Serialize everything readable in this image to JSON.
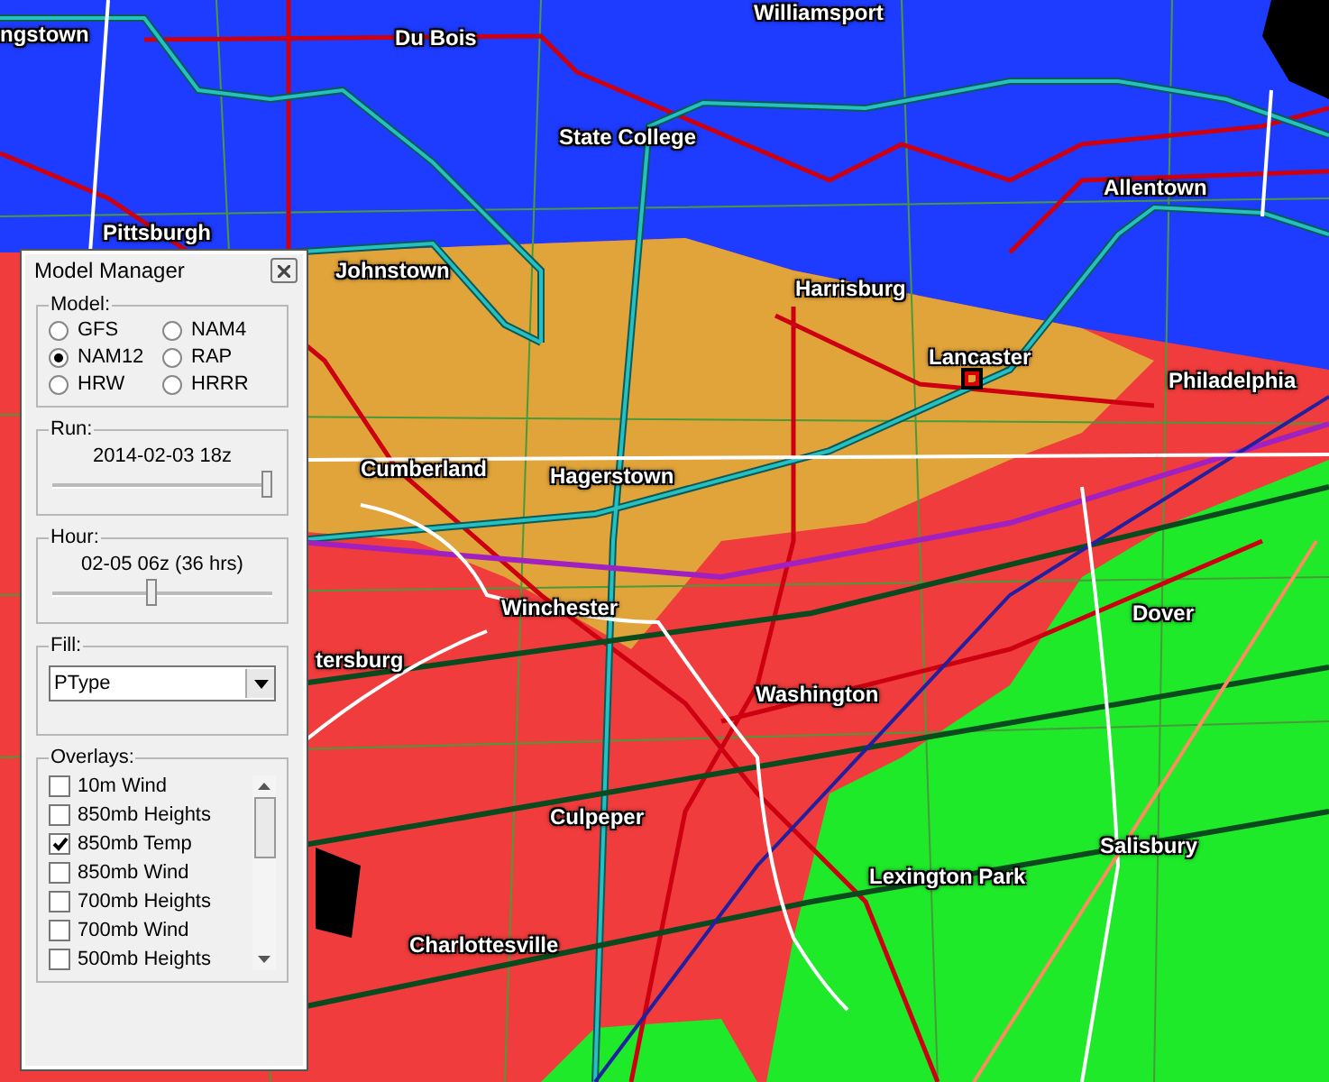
{
  "map": {
    "cities": [
      "ngstown",
      "Du Bois",
      "Williamsport",
      "State College",
      "Allentown",
      "Pittsburgh",
      "Johnstown",
      "Harrisburg",
      "Lancaster",
      "Philadelphia",
      "Cumberland",
      "Hagerstown",
      "Winchester",
      "Dover",
      "tersburg",
      "Washington",
      "Culpeper",
      "Salisbury",
      "Lexington Park",
      "Charlottesville"
    ]
  },
  "dialog": {
    "title": "Model Manager",
    "model": {
      "label": "Model:",
      "options": [
        {
          "label": "GFS",
          "selected": false
        },
        {
          "label": "NAM4",
          "selected": false
        },
        {
          "label": "NAM12",
          "selected": true
        },
        {
          "label": "RAP",
          "selected": false
        },
        {
          "label": "HRW",
          "selected": false
        },
        {
          "label": "HRRR",
          "selected": false
        }
      ]
    },
    "run": {
      "label": "Run:",
      "value": "2014-02-03 18z",
      "level": 1.0
    },
    "hour": {
      "label": "Hour:",
      "value": "02-05 06z (36 hrs)",
      "level": 0.45
    },
    "fill": {
      "label": "Fill:",
      "value": "PType"
    },
    "overlays": {
      "label": "Overlays:",
      "items": [
        {
          "label": "10m Wind",
          "checked": false
        },
        {
          "label": "850mb Heights",
          "checked": false
        },
        {
          "label": "850mb Temp",
          "checked": true
        },
        {
          "label": "850mb Wind",
          "checked": false
        },
        {
          "label": "700mb Heights",
          "checked": false
        },
        {
          "label": "700mb Wind",
          "checked": false
        },
        {
          "label": "500mb Heights",
          "checked": false
        }
      ]
    }
  }
}
